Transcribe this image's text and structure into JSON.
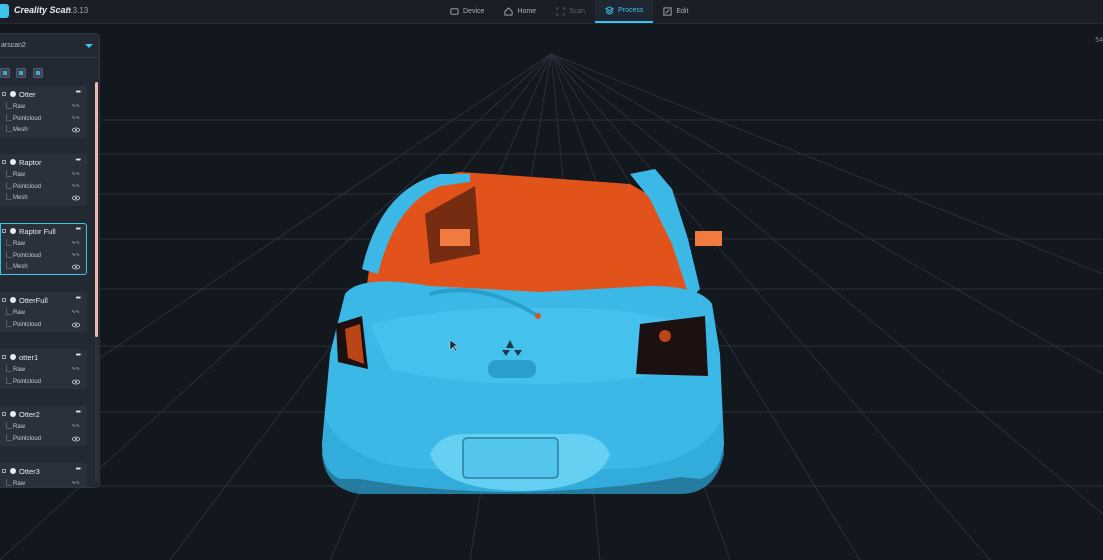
{
  "app": {
    "name": "Creality Scan",
    "version": "3.3.13"
  },
  "nav": {
    "tabs": [
      {
        "label": "Device",
        "icon": "device-icon",
        "state": "normal"
      },
      {
        "label": "Home",
        "icon": "home-icon",
        "state": "normal"
      },
      {
        "label": "Scan",
        "icon": "scan-icon",
        "state": "disabled"
      },
      {
        "label": "Process",
        "icon": "process-icon",
        "state": "active"
      },
      {
        "label": "Edit",
        "icon": "edit-icon",
        "state": "normal"
      }
    ]
  },
  "viewport": {
    "corner_label": "54"
  },
  "panel": {
    "project": "arscan2",
    "cards": [
      {
        "title": "Otter",
        "rows": [
          "Raw",
          "Pointcloud",
          "Mesh"
        ],
        "active": false
      },
      {
        "title": "Raptor",
        "rows": [
          "Raw",
          "Pointcloud",
          "Mesh"
        ],
        "active": false
      },
      {
        "title": "Raptor Full",
        "rows": [
          "Raw",
          "Pointcloud",
          "Mesh"
        ],
        "active": true
      },
      {
        "title": "OtterFull",
        "rows": [
          "Raw",
          "Pointcloud"
        ],
        "active": false
      },
      {
        "title": "otter1",
        "rows": [
          "Raw",
          "Pointcloud"
        ],
        "active": false
      },
      {
        "title": "Otter2",
        "rows": [
          "Raw",
          "Pointcloud"
        ],
        "active": false
      },
      {
        "title": "Otter3",
        "rows": [
          "Raw"
        ],
        "active": false
      }
    ]
  },
  "colors": {
    "accent": "#3cc4ee",
    "model_primary": "#3cb8e6",
    "model_interior": "#e2531c",
    "background": "#13171e"
  }
}
